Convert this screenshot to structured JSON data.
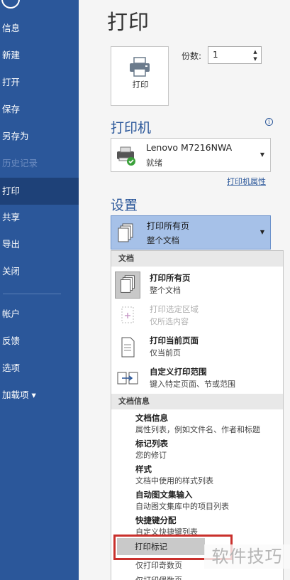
{
  "sidebar": {
    "items": [
      {
        "label": "信息",
        "state": "normal"
      },
      {
        "label": "新建",
        "state": "normal"
      },
      {
        "label": "打开",
        "state": "normal"
      },
      {
        "label": "保存",
        "state": "normal"
      },
      {
        "label": "另存为",
        "state": "normal"
      },
      {
        "label": "历史记录",
        "state": "disabled"
      },
      {
        "label": "打印",
        "state": "active"
      },
      {
        "label": "共享",
        "state": "normal"
      },
      {
        "label": "导出",
        "state": "normal"
      },
      {
        "label": "关闭",
        "state": "normal"
      },
      {
        "label": "帐户",
        "state": "normal"
      },
      {
        "label": "反馈",
        "state": "normal"
      },
      {
        "label": "选项",
        "state": "normal"
      },
      {
        "label": "加载项 ▾",
        "state": "normal"
      }
    ]
  },
  "main": {
    "title": "打印",
    "print_button": "打印",
    "copies_label": "份数:",
    "copies_value": "1",
    "printer_section": "打印机",
    "printer": {
      "name": "Lenovo M7216NWA",
      "status": "就绪"
    },
    "printer_properties": "打印机属性",
    "settings_section": "设置",
    "selected_setting": {
      "title": "打印所有页",
      "sub": "整个文档"
    }
  },
  "dropdown": {
    "group1": "文档",
    "options": [
      {
        "title": "打印所有页",
        "sub": "整个文档",
        "state": "selected",
        "icon": "pages-icon"
      },
      {
        "title": "打印选定区域",
        "sub": "仅所选内容",
        "state": "disabled",
        "icon": "selection-icon"
      },
      {
        "title": "打印当前页面",
        "sub": "仅当前页",
        "state": "normal",
        "icon": "page-icon"
      },
      {
        "title": "自定义打印范围",
        "sub": "键入特定页面、节或范围",
        "state": "normal",
        "icon": "custom-range-icon"
      }
    ],
    "group2": "文档信息",
    "info_options": [
      {
        "title": "文档信息",
        "sub": "属性列表，例如文件名、作者和标题"
      },
      {
        "title": "标记列表",
        "sub": "您的修订"
      },
      {
        "title": "样式",
        "sub": "文档中使用的样式列表"
      },
      {
        "title": "自动图文集输入",
        "sub": "自动图文集库中的项目列表"
      },
      {
        "title": "快捷键分配",
        "sub": "自定义快捷键列表"
      }
    ],
    "highlighted": "打印标记",
    "after": [
      "仅打印奇数页",
      "仅打印偶数页"
    ]
  },
  "watermark": "软件技巧",
  "colors": {
    "sidebar": "#2b579a",
    "active": "#1e4178",
    "accent": "#2b579a",
    "highlight_box": "#c9302c"
  }
}
